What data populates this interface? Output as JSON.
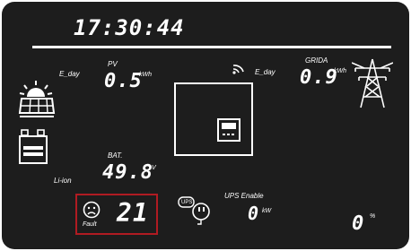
{
  "display": {
    "time": "17:30:44",
    "pv": {
      "label": "PV",
      "value": "0.5",
      "unit": "kWh",
      "day_label": "E_day"
    },
    "grid": {
      "label": "GRIDA",
      "value": "0.9",
      "unit": "kWh",
      "day_label": "E_day"
    },
    "battery": {
      "label": "BAT.",
      "value": "49.8",
      "unit": "V",
      "type_label": "Li-ion"
    },
    "fault": {
      "label": "Fault",
      "code": "21"
    },
    "ups": {
      "badge": "UPS",
      "enable_label": "UPS Enable",
      "value": "0",
      "unit": "kW"
    },
    "load": {
      "value": "0",
      "unit": "%"
    }
  },
  "icons": [
    "sun-icon",
    "solar-panel-icon",
    "battery-icon",
    "wifi-signal-icon",
    "power-tower-icon",
    "inverter-icon",
    "sad-face-icon",
    "ups-plug-icon"
  ],
  "colors": {
    "background": "#1d1d1d",
    "segment": "#ffffff",
    "fault_highlight": "#b01b22"
  }
}
